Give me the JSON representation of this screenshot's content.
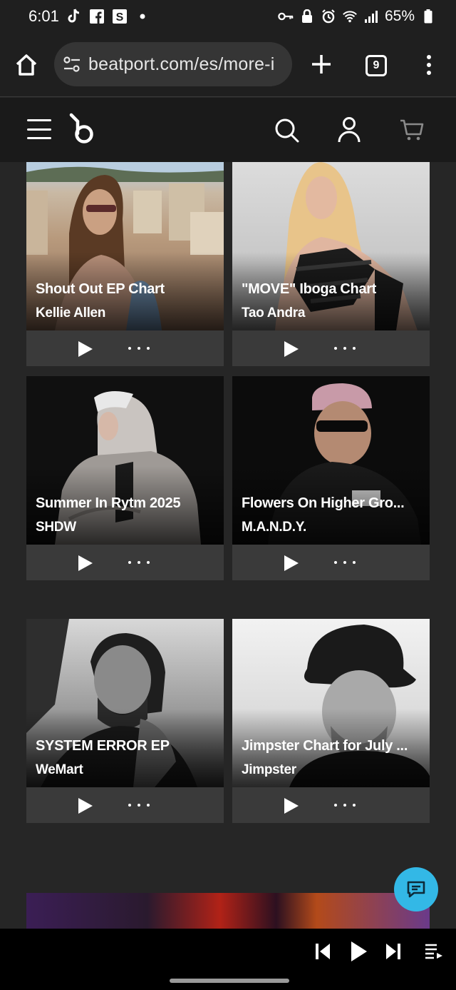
{
  "status_bar": {
    "time": "6:01",
    "battery": "65%",
    "left_icons": [
      "tiktok-icon",
      "facebook-icon",
      "s-app-icon",
      "dot-icon"
    ],
    "right_icons": [
      "key-icon",
      "lock-icon",
      "alarm-icon",
      "wifi-icon",
      "signal-icon",
      "battery-icon"
    ]
  },
  "browser": {
    "url": "beatport.com/es/more-i",
    "tab_count": "9"
  },
  "header": {
    "menu_icon": "hamburger-icon",
    "logo": "beatport-logo",
    "search_icon": "search-icon",
    "account_icon": "user-icon",
    "cart_icon": "cart-icon"
  },
  "cards": [
    {
      "title": "Shout Out EP Chart",
      "artist": "Kellie Allen"
    },
    {
      "title": "\"MOVE\" Iboga Chart",
      "artist": "Tao Andra"
    },
    {
      "title": "Summer In Rytm 2025",
      "artist": "SHDW"
    },
    {
      "title": "Flowers On Higher Gro...",
      "artist": "M.A.N.D.Y."
    },
    {
      "title": "SYSTEM ERROR EP",
      "artist": "WeMart"
    },
    {
      "title": "Jimpster Chart for July ...",
      "artist": "Jimpster"
    }
  ],
  "colors": {
    "background": "#262626",
    "header": "#1a1a1a",
    "controls": "#3a3a3a",
    "chat_accent": "#33b8e6"
  }
}
